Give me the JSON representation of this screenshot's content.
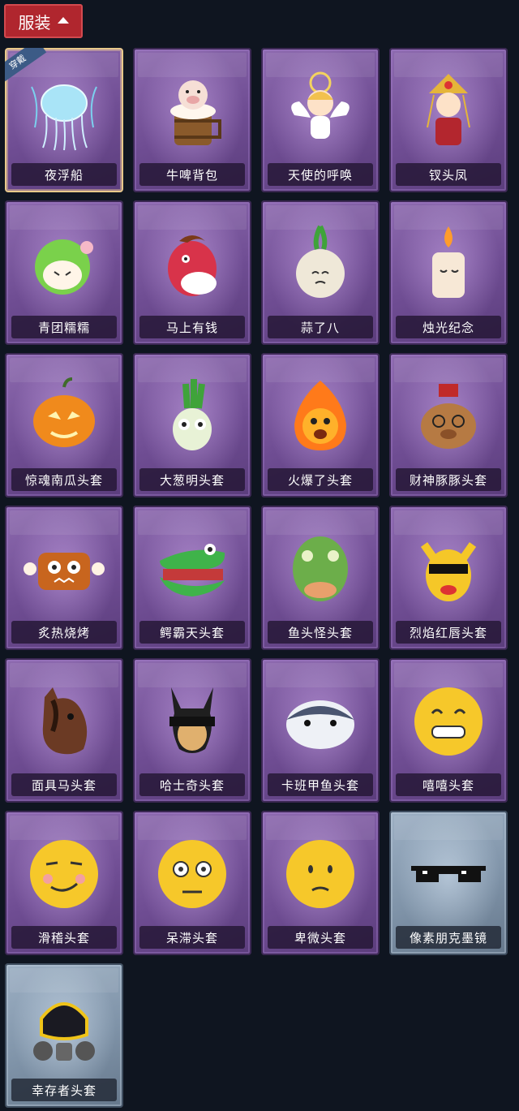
{
  "header": {
    "title": "服装"
  },
  "equipped_badge": "穿戴",
  "items": [
    {
      "name": "夜浮船",
      "icon": "jellyfish-icon",
      "equipped": true
    },
    {
      "name": "牛啤背包",
      "icon": "beer-barrel-pig-icon"
    },
    {
      "name": "天使的呼唤",
      "icon": "angel-icon"
    },
    {
      "name": "钗头凤",
      "icon": "phoenix-headdress-icon"
    },
    {
      "name": "青团糯糯",
      "icon": "green-dumpling-icon"
    },
    {
      "name": "马上有钱",
      "icon": "red-horse-mask-icon"
    },
    {
      "name": "蒜了八",
      "icon": "garlic-icon"
    },
    {
      "name": "烛光纪念",
      "icon": "candle-icon"
    },
    {
      "name": "惊魂南瓜头套",
      "icon": "pumpkin-icon"
    },
    {
      "name": "大葱明头套",
      "icon": "scallion-icon"
    },
    {
      "name": "火爆了头套",
      "icon": "fire-spirit-icon"
    },
    {
      "name": "财神豚豚头套",
      "icon": "capybara-god-of-wealth-icon"
    },
    {
      "name": "炙热烧烤",
      "icon": "bbq-meat-icon"
    },
    {
      "name": "鳄霸天头套",
      "icon": "crocodile-icon"
    },
    {
      "name": "鱼头怪头套",
      "icon": "fish-head-icon"
    },
    {
      "name": "烈焰红唇头套",
      "icon": "yellow-mouse-sunglasses-icon"
    },
    {
      "name": "面具马头套",
      "icon": "horse-mask-icon"
    },
    {
      "name": "哈士奇头套",
      "icon": "husky-sunglasses-icon"
    },
    {
      "name": "卡班甲鱼头套",
      "icon": "fish-blob-icon"
    },
    {
      "name": "嘻嘻头套",
      "icon": "grin-emoji-icon"
    },
    {
      "name": "滑稽头套",
      "icon": "smirk-emoji-icon"
    },
    {
      "name": "呆滞头套",
      "icon": "stare-emoji-icon"
    },
    {
      "name": "卑微头套",
      "icon": "humble-emoji-icon"
    },
    {
      "name": "像素朋克墨镜",
      "icon": "pixel-sunglasses-icon",
      "rarity": "gray"
    },
    {
      "name": "幸存者头套",
      "icon": "gas-mask-icon",
      "rarity": "gray"
    }
  ]
}
